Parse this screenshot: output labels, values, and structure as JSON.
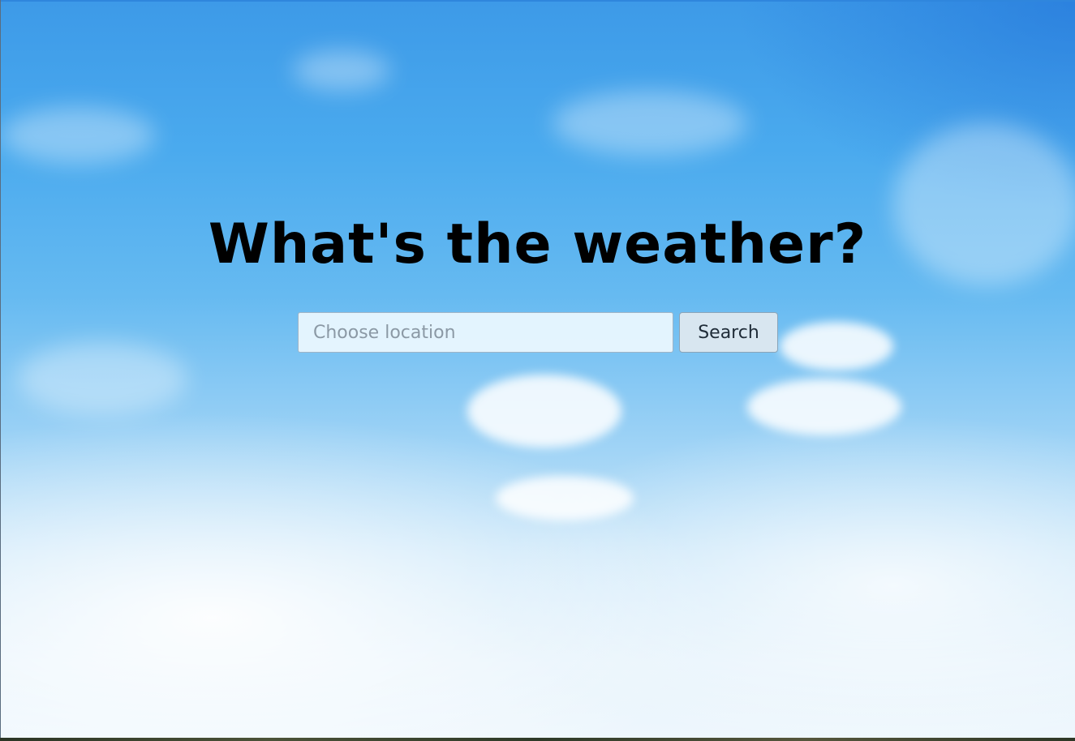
{
  "page": {
    "headline": "What's the weather?"
  },
  "search": {
    "placeholder": "Choose location",
    "value": "",
    "button_label": "Search"
  }
}
